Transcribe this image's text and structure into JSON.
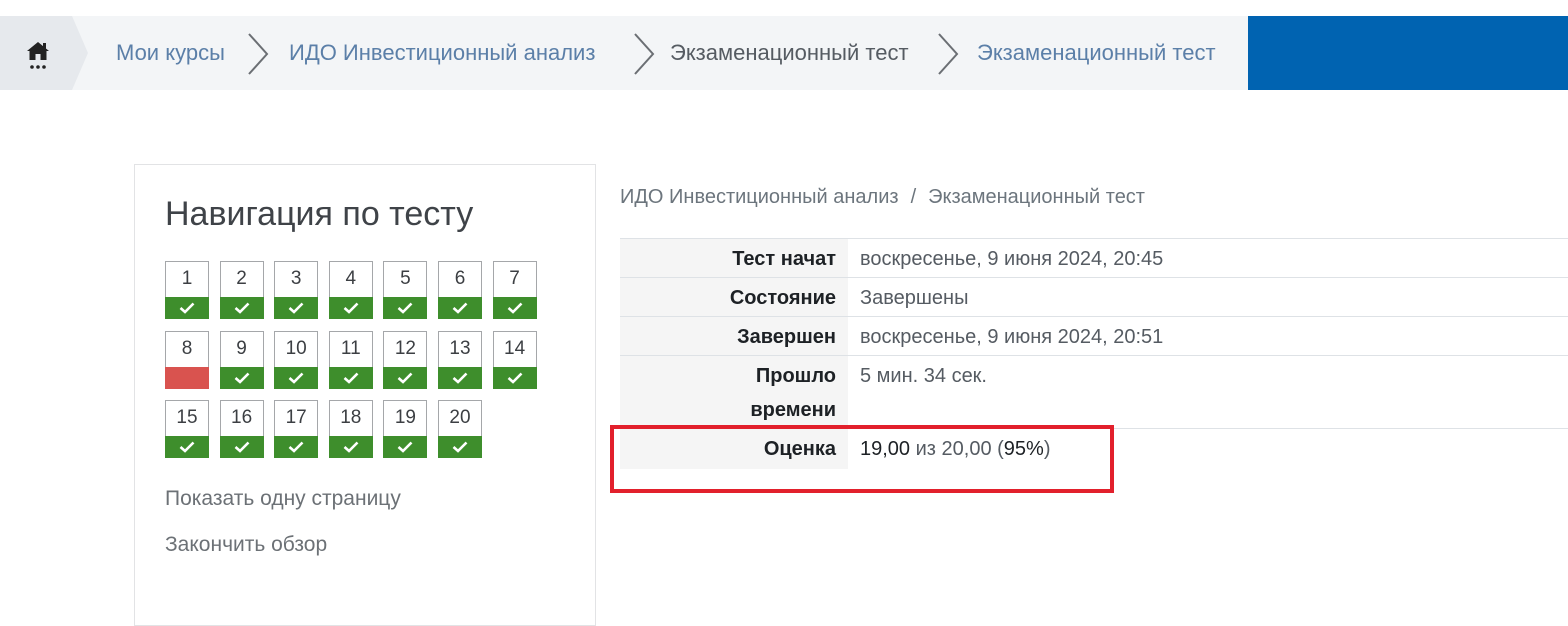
{
  "breadcrumb": {
    "home_icon": "home-icon",
    "items": [
      {
        "label": "Мои курсы",
        "link": true
      },
      {
        "label": "ИДО Инвестиционный анализ",
        "link": true
      },
      {
        "label": "Экзаменационный тест",
        "link": false
      },
      {
        "label": "Экзаменационный тест",
        "link": true
      }
    ]
  },
  "quiz_nav": {
    "title": "Навигация по тесту",
    "questions": [
      {
        "num": "1",
        "status": "correct"
      },
      {
        "num": "2",
        "status": "correct"
      },
      {
        "num": "3",
        "status": "correct"
      },
      {
        "num": "4",
        "status": "correct"
      },
      {
        "num": "5",
        "status": "correct"
      },
      {
        "num": "6",
        "status": "correct"
      },
      {
        "num": "7",
        "status": "correct"
      },
      {
        "num": "8",
        "status": "incorrect"
      },
      {
        "num": "9",
        "status": "correct"
      },
      {
        "num": "10",
        "status": "correct"
      },
      {
        "num": "11",
        "status": "correct"
      },
      {
        "num": "12",
        "status": "correct"
      },
      {
        "num": "13",
        "status": "correct"
      },
      {
        "num": "14",
        "status": "correct"
      },
      {
        "num": "15",
        "status": "correct"
      },
      {
        "num": "16",
        "status": "correct"
      },
      {
        "num": "17",
        "status": "correct"
      },
      {
        "num": "18",
        "status": "correct"
      },
      {
        "num": "19",
        "status": "correct"
      },
      {
        "num": "20",
        "status": "correct"
      }
    ],
    "show_one_page": "Показать одну страницу",
    "finish_review": "Закончить обзор"
  },
  "course_path": {
    "course": "ИДО Инвестиционный анализ",
    "separator": "/",
    "quiz": "Экзаменационный тест"
  },
  "summary": {
    "started_label": "Тест начат",
    "started_value": "воскресенье, 9 июня 2024, 20:45",
    "state_label": "Состояние",
    "state_value": "Завершены",
    "completed_label": "Завершен",
    "completed_value": "воскресенье, 9 июня 2024, 20:51",
    "time_label_1": "Прошло",
    "time_label_2": "времени",
    "time_value": "5 мин. 34 сек.",
    "grade_label": "Оценка",
    "grade_score": "19,00",
    "grade_of": "из 20,00 (",
    "grade_percent": "95%",
    "grade_close": ")"
  },
  "colors": {
    "correct": "#3e8e2c",
    "incorrect": "#d9534f",
    "accent_blue": "#0063b1",
    "highlight": "#e2202c"
  }
}
